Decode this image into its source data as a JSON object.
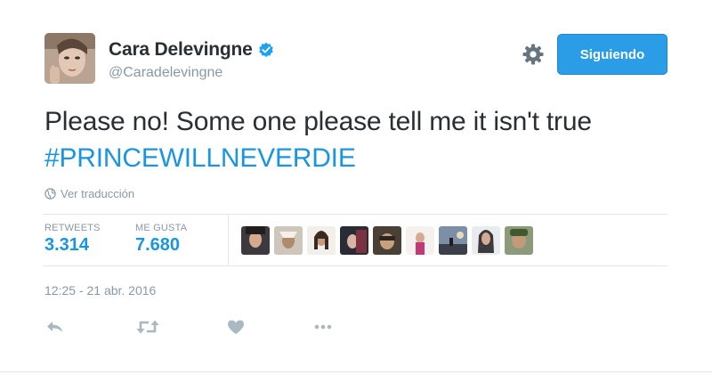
{
  "author": {
    "name": "Cara Delevingne",
    "handle": "@Caradelevingne",
    "verified": true
  },
  "follow_button_label": "Siguiendo",
  "tweet": {
    "text_line1": "Please no! Some one please tell me it isn't true",
    "hashtag": "#PRINCEWILLNEVERDIE"
  },
  "translate_label": "Ver traducción",
  "stats": {
    "retweets_label": "RETWEETS",
    "retweets_value": "3.314",
    "likes_label": "ME GUSTA",
    "likes_value": "7.680"
  },
  "liker_avatars_count": 9,
  "timestamp": "12:25 - 21 abr. 2016",
  "actions": [
    "reply-icon",
    "retweet-icon",
    "like-icon",
    "more-icon"
  ],
  "colors": {
    "accent": "#1b95e0",
    "button": "#2b9de6",
    "muted": "#8899a6",
    "text": "#292f33",
    "divider": "#e1e8ed"
  }
}
